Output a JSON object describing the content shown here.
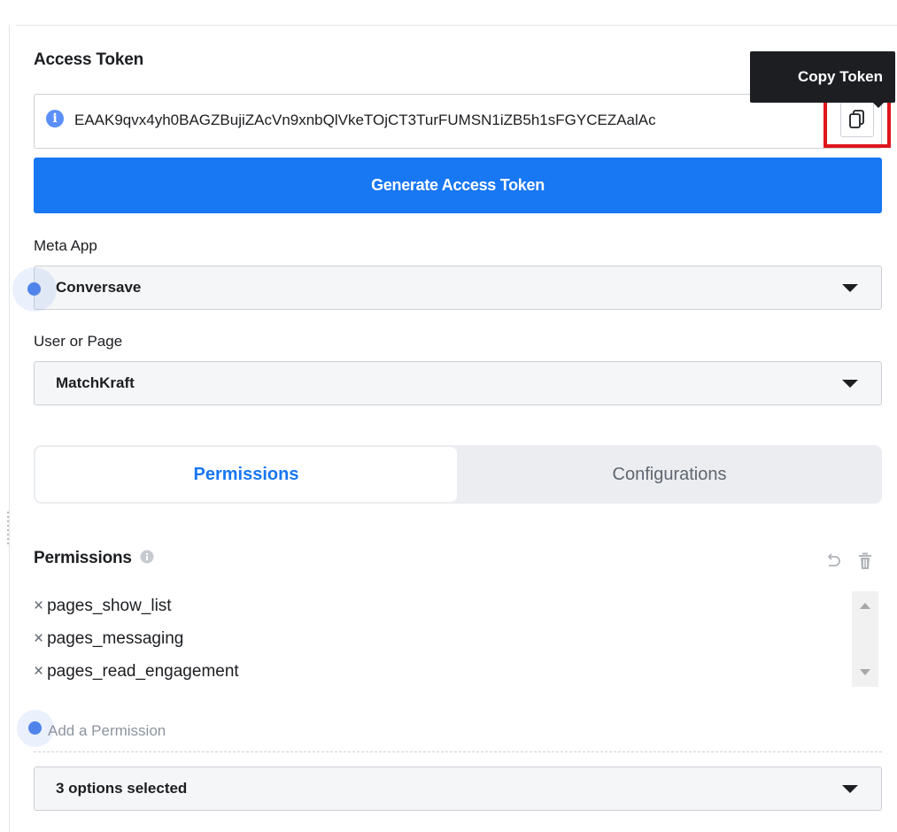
{
  "access_token": {
    "heading": "Access Token",
    "value": "EAAK9qvx4yh0BAGZBujiZAcVn9xnbQlVkeTOjCT3TurFUMSN1iZB5h1sFGYCEZAalAc",
    "info_icon": "info-icon",
    "copy_icon": "copy-icon",
    "tooltip": "Copy Token",
    "generate_label": "Generate Access Token"
  },
  "meta_app": {
    "label": "Meta App",
    "selected": "Conversave"
  },
  "user_or_page": {
    "label": "User or Page",
    "selected": "MatchKraft"
  },
  "tabs": [
    {
      "label": "Permissions",
      "active": true
    },
    {
      "label": "Configurations",
      "active": false
    }
  ],
  "permissions": {
    "heading": "Permissions",
    "items": [
      "pages_show_list",
      "pages_messaging",
      "pages_read_engagement"
    ],
    "add_placeholder": "Add a Permission",
    "options_selected": "3 options selected",
    "remove_glyph": "×",
    "undo_icon": "undo-icon",
    "trash_icon": "trash-icon"
  },
  "colors": {
    "primary_button": "#1877f2",
    "active_tab_text": "#1877f2",
    "highlight_box": "#e0161c",
    "tooltip_bg": "#1c1e21"
  }
}
